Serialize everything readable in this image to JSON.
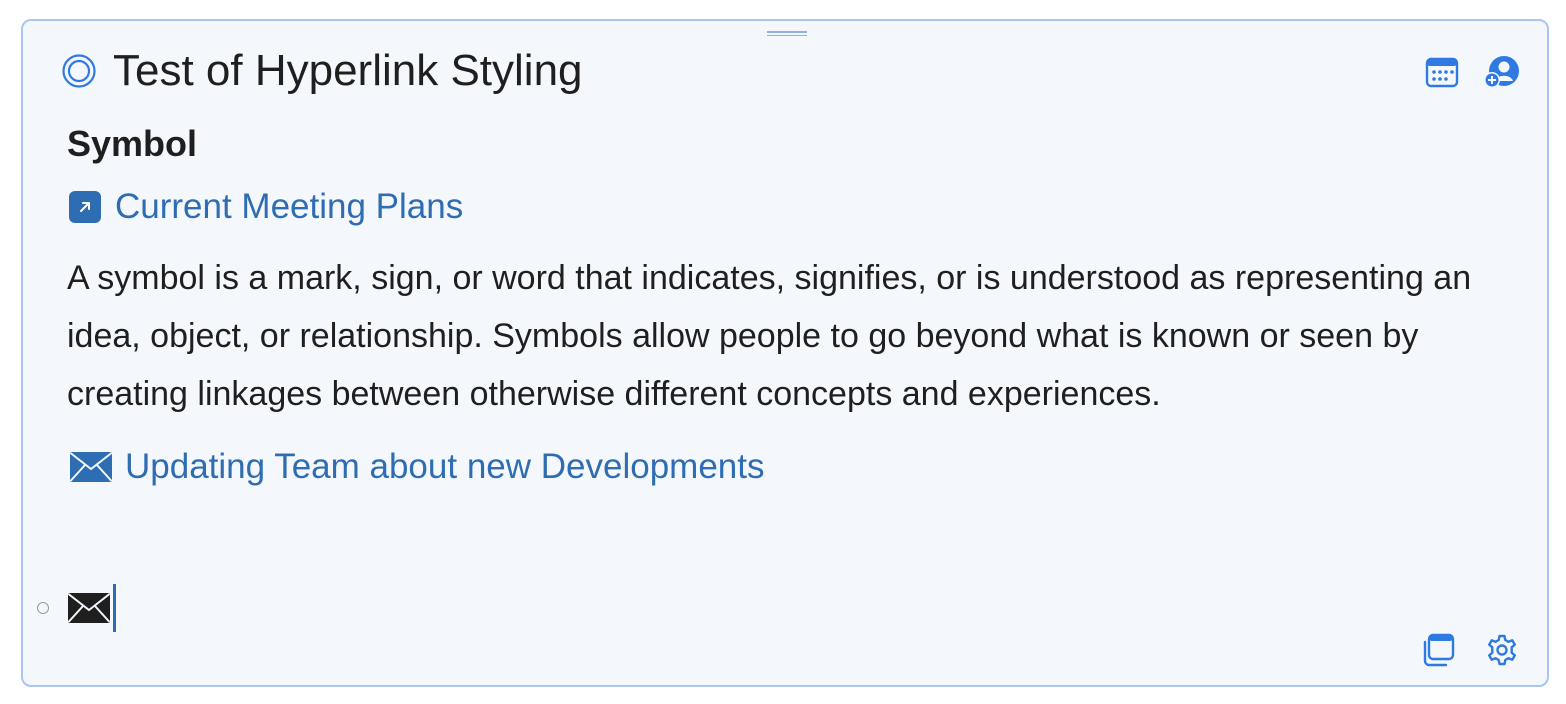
{
  "note": {
    "title": "Test of Hyperlink Styling",
    "section_heading": "Symbol",
    "links": {
      "meeting": {
        "label": "Current Meeting Plans",
        "icon": "arrow-up-right-box-icon"
      },
      "email": {
        "label": "Updating Team about new Developments",
        "icon": "envelope-icon"
      }
    },
    "body": "A symbol is a mark, sign, or word that indicates, signifies, or is understood as representing an idea, object, or relationship. Symbols allow people to go beyond what is known or seen by creating linkages between otherwise different concepts and experiences."
  },
  "toolbar": {
    "top": [
      "calendar-icon",
      "add-person-icon"
    ],
    "bottom": [
      "copy-icon",
      "gear-icon"
    ]
  },
  "colors": {
    "accent": "#2f6db3",
    "border": "#a9c6f2",
    "background": "#f4f8fd",
    "text": "#1f1f1f"
  }
}
